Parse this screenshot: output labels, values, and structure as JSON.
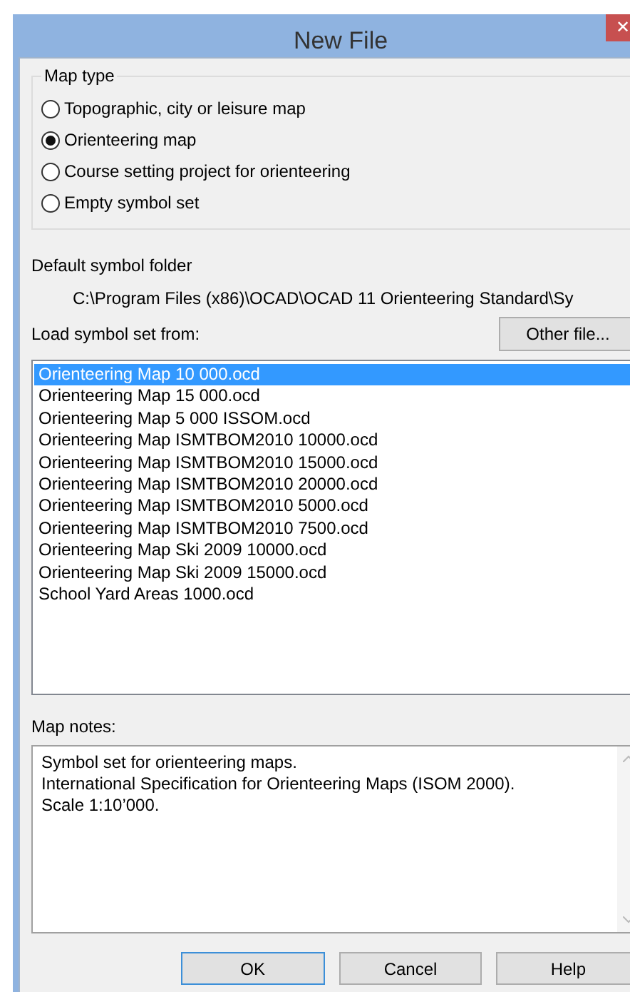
{
  "window": {
    "title": "New File",
    "close": "✕"
  },
  "map_type": {
    "legend": "Map type",
    "options": [
      {
        "label": "Topographic, city or leisure map",
        "selected": false
      },
      {
        "label": "Orienteering map",
        "selected": true
      },
      {
        "label": "Course setting project for orienteering",
        "selected": false
      },
      {
        "label": "Empty symbol set",
        "selected": false
      }
    ]
  },
  "default_symbol_folder": {
    "label": "Default symbol folder",
    "path": "C:\\Program Files (x86)\\OCAD\\OCAD 11 Orienteering Standard\\Sy"
  },
  "load_symbol_set": {
    "label": "Load symbol set from:",
    "button": "Other file...",
    "items": [
      {
        "label": "Orienteering Map 10 000.ocd",
        "selected": true
      },
      {
        "label": "Orienteering Map 15 000.ocd",
        "selected": false
      },
      {
        "label": "Orienteering Map 5 000 ISSOM.ocd",
        "selected": false
      },
      {
        "label": "Orienteering Map ISMTBOM2010 10000.ocd",
        "selected": false
      },
      {
        "label": "Orienteering Map ISMTBOM2010 15000.ocd",
        "selected": false
      },
      {
        "label": "Orienteering Map ISMTBOM2010 20000.ocd",
        "selected": false
      },
      {
        "label": "Orienteering Map ISMTBOM2010 5000.ocd",
        "selected": false
      },
      {
        "label": "Orienteering Map ISMTBOM2010 7500.ocd",
        "selected": false
      },
      {
        "label": "Orienteering Map Ski 2009 10000.ocd",
        "selected": false
      },
      {
        "label": "Orienteering Map Ski 2009 15000.ocd",
        "selected": false
      },
      {
        "label": "School Yard Areas 1000.ocd",
        "selected": false
      }
    ]
  },
  "map_notes": {
    "label": "Map notes:",
    "lines": [
      "Symbol set for orienteering maps.",
      "International Specification for Orienteering Maps (ISOM 2000).",
      "Scale 1:10’000."
    ]
  },
  "buttons": [
    {
      "label": "OK",
      "selected": true
    },
    {
      "label": "Cancel",
      "selected": false
    },
    {
      "label": "Help",
      "selected": false
    }
  ]
}
